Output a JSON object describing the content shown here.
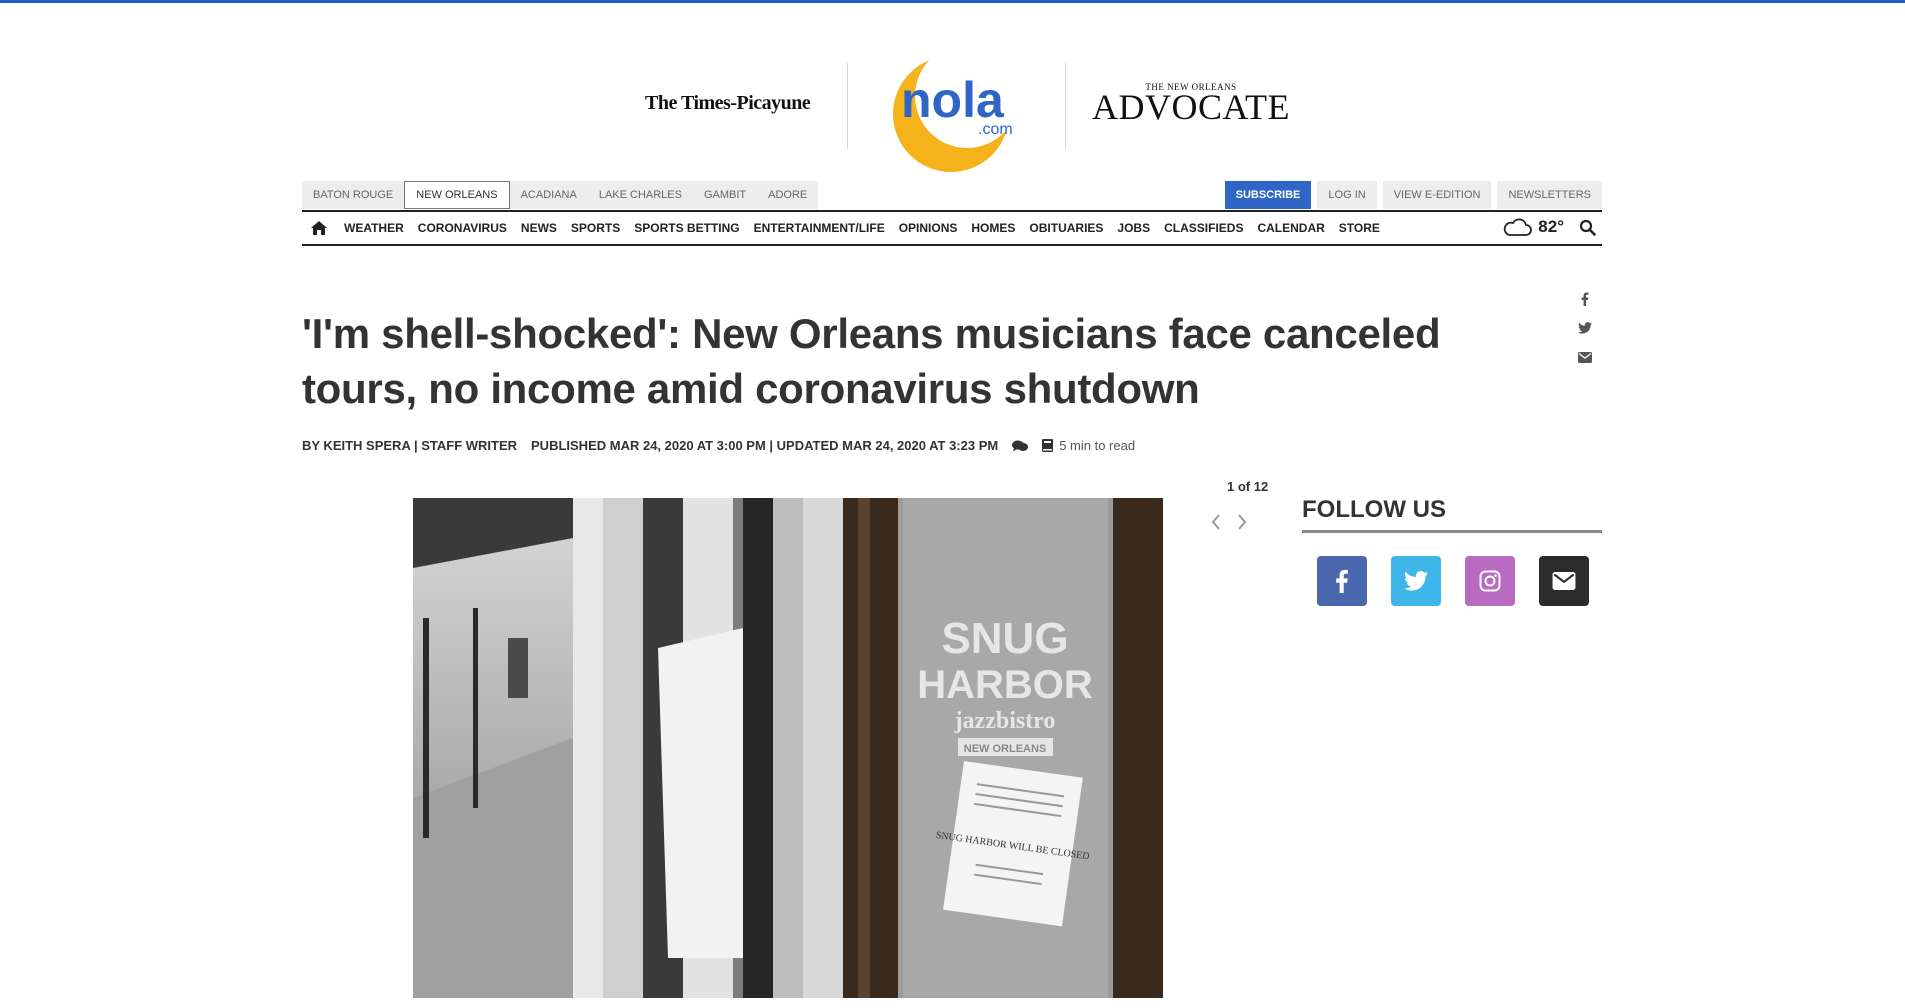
{
  "masthead": {
    "times_picayune": "The Times-Picayune",
    "nola_main": "nola",
    "nola_com": ".com",
    "advocate_small": "THE NEW ORLEANS",
    "advocate_big": "ADVOCATE"
  },
  "editions": [
    "BATON ROUGE",
    "NEW ORLEANS",
    "ACADIANA",
    "LAKE CHARLES",
    "GAMBIT",
    "ADORE"
  ],
  "account": {
    "subscribe": "SUBSCRIBE",
    "login": "LOG IN",
    "eedition": "VIEW E-EDITION",
    "newsletters": "NEWSLETTERS"
  },
  "nav": {
    "items": [
      "WEATHER",
      "CORONAVIRUS",
      "NEWS",
      "SPORTS",
      "SPORTS BETTING",
      "ENTERTAINMENT/LIFE",
      "OPINIONS",
      "HOMES",
      "OBITUARIES",
      "JOBS",
      "CLASSIFIEDS",
      "CALENDAR",
      "STORE"
    ],
    "temperature": "82°"
  },
  "article": {
    "headline": "'I'm shell-shocked': New Orleans musicians face canceled tours, no income amid coronavirus shutdown",
    "author": "BY KEITH SPERA | STAFF WRITER",
    "dates": "PUBLISHED MAR 24, 2020 AT 3:00 PM | UPDATED MAR 24, 2020 AT 3:23 PM",
    "read_time": "5 min to read"
  },
  "gallery": {
    "counter": "1 of 12",
    "sign_line1": "SNUG",
    "sign_line2": "HARBOR",
    "sign_line3": "jazzbistro",
    "sign_line4": "NEW ORLEANS",
    "notice": "SNUG HARBOR WILL BE CLOSED"
  },
  "follow": {
    "title": "FOLLOW US"
  },
  "colors": {
    "accent_blue": "#2f66c6",
    "facebook": "#4a67ad",
    "twitter": "#3fb6ea",
    "instagram": "#b96bc1",
    "email": "#2b2b2b",
    "nola_yellow": "#f5b21b"
  }
}
